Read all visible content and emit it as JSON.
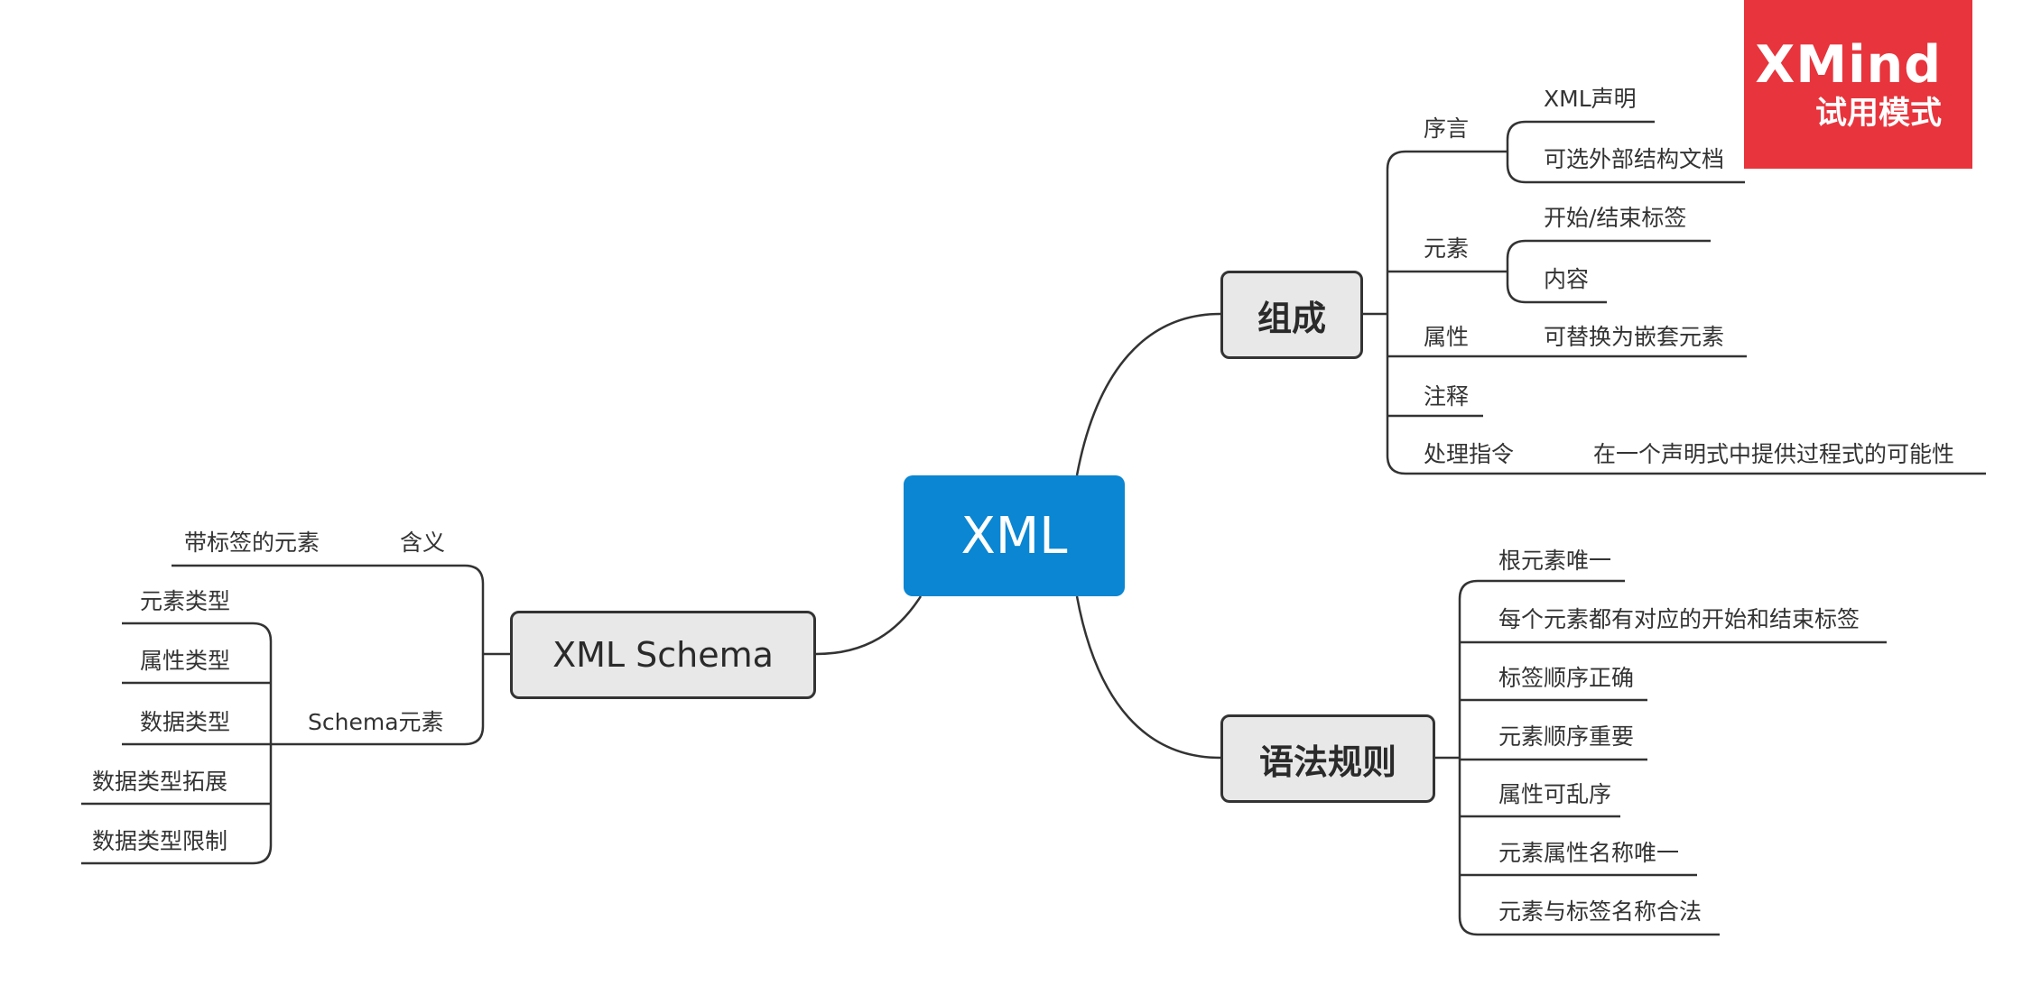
{
  "colors": {
    "root": "#0a86d2",
    "watermark": "#e8343c",
    "line": "#333333",
    "node_fill": "#e8e8e8"
  },
  "root": {
    "label": "XML"
  },
  "composition": {
    "label": "组成",
    "preface": {
      "label": "序言",
      "children": [
        "XML声明",
        "可选外部结构文档"
      ]
    },
    "element": {
      "label": "元素",
      "children": [
        "开始/结束标签",
        "内容"
      ]
    },
    "attribute": {
      "label": "属性",
      "children": [
        "可替换为嵌套元素"
      ]
    },
    "comment": {
      "label": "注释"
    },
    "processing": {
      "label": "处理指令",
      "children": [
        "在一个声明式中提供过程式的可能性"
      ]
    }
  },
  "syntax": {
    "label": "语法规则",
    "children": [
      "根元素唯一",
      "每个元素都有对应的开始和结束标签",
      "标签顺序正确",
      "元素顺序重要",
      "属性可乱序",
      "元素属性名称唯一",
      "元素与标签名称合法"
    ]
  },
  "schema": {
    "label": "XML Schema",
    "meaning": {
      "label": "含义",
      "children": [
        "带标签的元素"
      ]
    },
    "schema_elements": {
      "label": "Schema元素",
      "children": [
        "元素类型",
        "属性类型",
        "数据类型",
        "数据类型拓展",
        "数据类型限制"
      ]
    }
  },
  "watermark": {
    "brand": "XMind",
    "mode": "试用模式"
  }
}
